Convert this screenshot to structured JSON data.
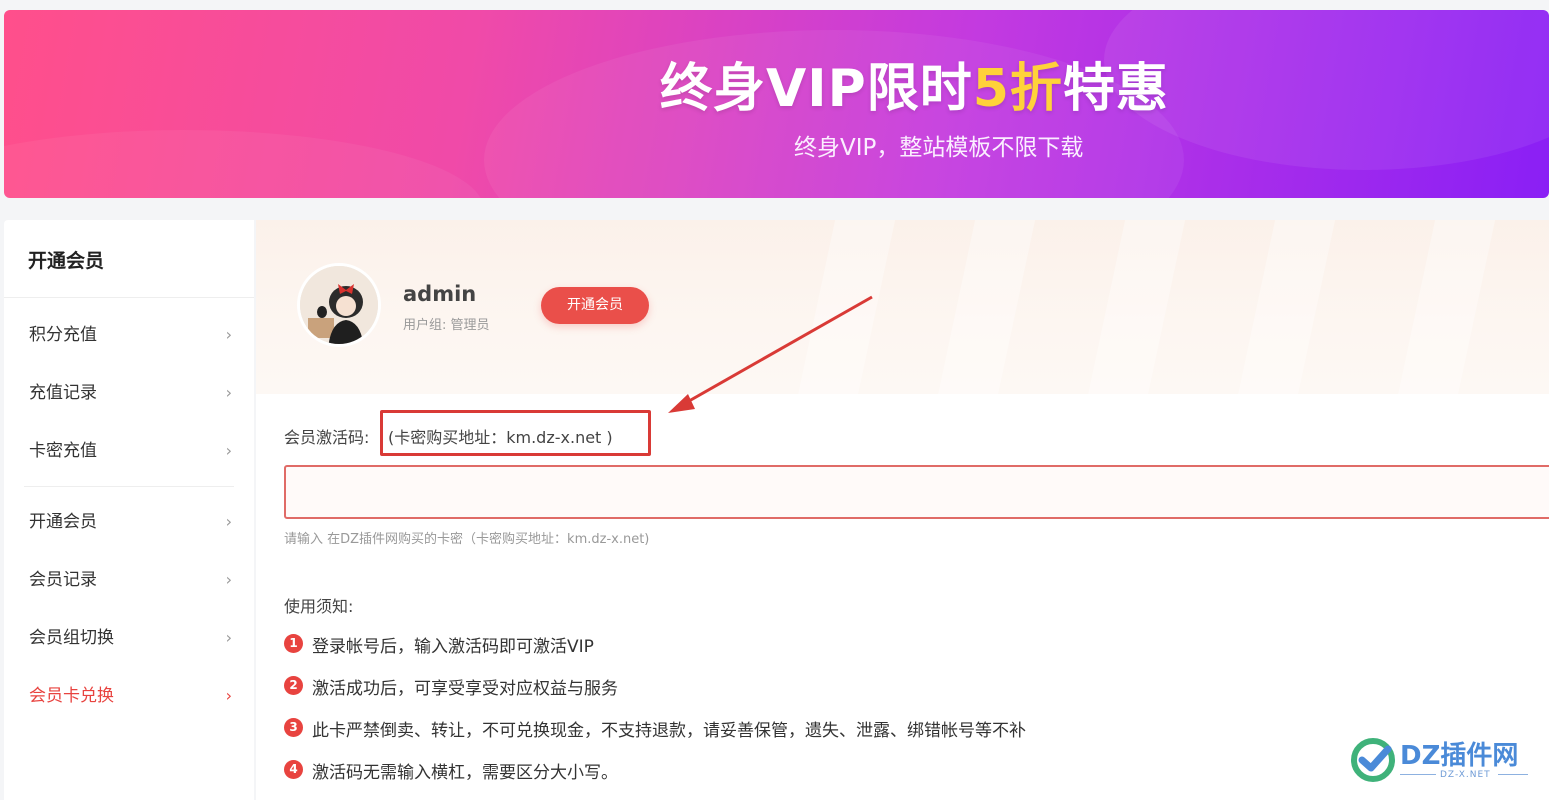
{
  "banner": {
    "title_pre": "终身VIP限时",
    "title_highlight": "5折",
    "title_post": "特惠",
    "subtitle": "终身VIP，整站模板不限下载"
  },
  "sidebar": {
    "heading": "开通会员",
    "items": [
      {
        "label": "积分充值"
      },
      {
        "label": "充值记录"
      },
      {
        "label": "卡密充值"
      },
      {
        "label": "开通会员"
      },
      {
        "label": "会员记录"
      },
      {
        "label": "会员组切换"
      },
      {
        "label": "会员卡兑换",
        "active": true
      }
    ],
    "chevron": "›"
  },
  "profile": {
    "username": "admin",
    "usergroup": "用户组: 管理员",
    "open_button": "开通会员"
  },
  "form": {
    "label": "会员激活码:",
    "note": "(卡密购买地址：km.dz-x.net )",
    "input_value": "",
    "hint": "请输入 在DZ插件网购买的卡密（卡密购买地址：km.dz-x.net)"
  },
  "notice": {
    "title": "使用须知:",
    "items": [
      {
        "num": "1",
        "text": "登录帐号后，输入激活码即可激活VIP"
      },
      {
        "num": "2",
        "text": "激活成功后，可享受享受对应权益与服务"
      },
      {
        "num": "3",
        "text": "此卡严禁倒卖、转让，不可兑换现金，不支持退款，请妥善保管，遗失、泄露、绑错帐号等不补"
      },
      {
        "num": "4",
        "text": "激活码无需输入横杠，需要区分大小写。"
      }
    ]
  },
  "watermark": {
    "text": "DZ插件网",
    "sub": "DZ-X.NET"
  },
  "colors": {
    "accent": "#e8433f",
    "banner_start": "#ff4f8b",
    "banner_end": "#8a1ff5",
    "highlight": "#ffd23a"
  }
}
